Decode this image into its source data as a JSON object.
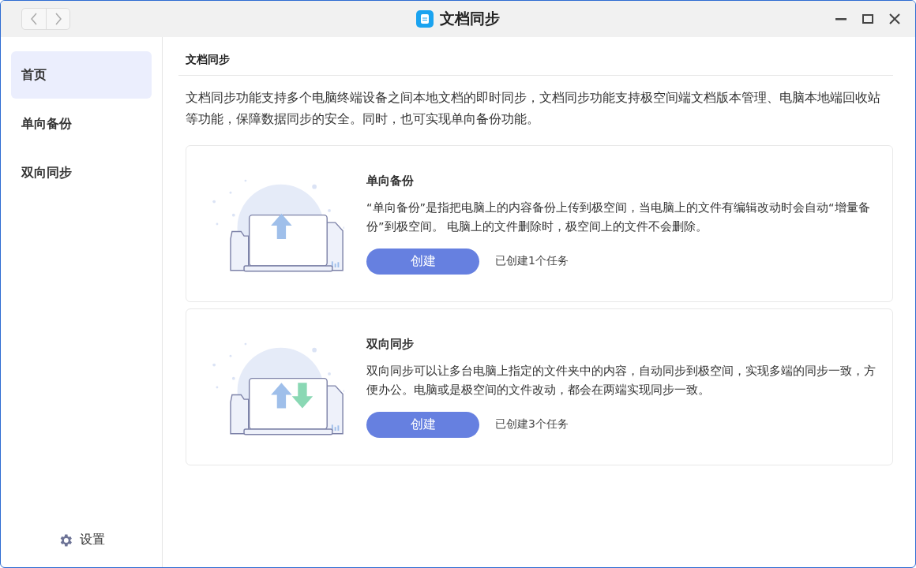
{
  "window": {
    "title": "文档同步"
  },
  "sidebar": {
    "items": [
      {
        "label": "首页",
        "selected": true
      },
      {
        "label": "单向备份",
        "selected": false
      },
      {
        "label": "双向同步",
        "selected": false
      }
    ],
    "settings": "设置"
  },
  "section_title": "文档同步",
  "intro": "文档同步功能支持多个电脑终端设备之间本地文档的即时同步，文档同步功能支持极空间端文档版本管理、电脑本地端回收站等功能，保障数据同步的安全。同时，也可实现单向备份功能。",
  "cards": [
    {
      "kind": "upload",
      "title": "单向备份",
      "description": "“单向备份”是指把电脑上的内容备份上传到极空间，当电脑上的文件有编辑改动时会自动“增量备份”到极空间。 电脑上的文件删除时，极空间上的文件不会删除。",
      "button": "创建",
      "status": "已创建1个任务"
    },
    {
      "kind": "sync",
      "title": "双向同步",
      "description": "双向同步可以让多台电脑上指定的文件夹中的内容，自动同步到极空间，实现多端的同步一致，方便办公。电脑或是极空间的文件改动，都会在两端实现同步一致。",
      "button": "创建",
      "status": "已创建3个任务"
    }
  ]
}
